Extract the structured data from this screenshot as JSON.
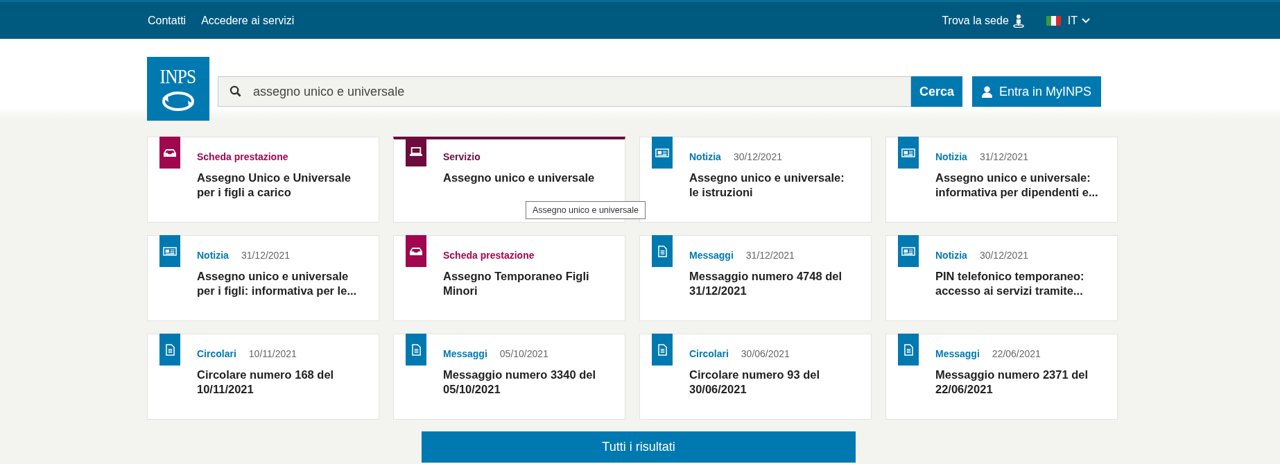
{
  "top_bar": {
    "links": [
      "Contatti",
      "Accedere ai servizi"
    ],
    "find_office": "Trova la sede",
    "language": "IT"
  },
  "header": {
    "logo": "INPS",
    "search": {
      "value": "assegno unico e universale"
    },
    "search_button": "Cerca",
    "login_button": "Entra in MyINPS"
  },
  "results": [
    {
      "kind": "scheda",
      "color": "#a0074f",
      "category": "Scheda prestazione",
      "title": "Assegno Unico e Universale per i figli a carico",
      "selected": false
    },
    {
      "kind": "servizio",
      "color": "#6d0b3c",
      "category": "Servizio",
      "title": "Assegno unico e universale",
      "selected": true,
      "tooltip": "Assegno unico e universale"
    },
    {
      "kind": "notizia",
      "color": "#0079b1",
      "category": "Notizia",
      "date": "30/12/2021",
      "title": "Assegno unico e universale: le istruzioni",
      "selected": false
    },
    {
      "kind": "notizia",
      "color": "#0079b1",
      "category": "Notizia",
      "date": "31/12/2021",
      "title": "Assegno unico e universale: informativa per dipendenti e...",
      "selected": false
    },
    {
      "kind": "notizia",
      "color": "#0079b1",
      "category": "Notizia",
      "date": "31/12/2021",
      "title": "Assegno unico e universale per i figli: informativa per le...",
      "selected": false
    },
    {
      "kind": "scheda",
      "color": "#a0074f",
      "category": "Scheda prestazione",
      "title": "Assegno Temporaneo Figli Minori",
      "selected": false
    },
    {
      "kind": "documento",
      "color": "#0079b1",
      "category": "Messaggi",
      "date": "31/12/2021",
      "title": "Messaggio numero 4748 del 31/12/2021",
      "selected": false
    },
    {
      "kind": "notizia",
      "color": "#0079b1",
      "category": "Notizia",
      "date": "30/12/2021",
      "title": "PIN telefonico temporaneo: accesso ai servizi tramite...",
      "selected": false
    },
    {
      "kind": "documento",
      "color": "#0079b1",
      "category": "Circolari",
      "date": "10/11/2021",
      "title": "Circolare numero 168 del 10/11/2021",
      "selected": false
    },
    {
      "kind": "documento",
      "color": "#0079b1",
      "category": "Messaggi",
      "date": "05/10/2021",
      "title": "Messaggio numero 3340 del 05/10/2021",
      "selected": false
    },
    {
      "kind": "documento",
      "color": "#0079b1",
      "category": "Circolari",
      "date": "30/06/2021",
      "title": "Circolare numero 93 del 30/06/2021",
      "selected": false
    },
    {
      "kind": "documento",
      "color": "#0079b1",
      "category": "Messaggi",
      "date": "22/06/2021",
      "title": "Messaggio numero 2371 del 22/06/2021",
      "selected": false
    }
  ],
  "all_results_button": "Tutti i risultati"
}
